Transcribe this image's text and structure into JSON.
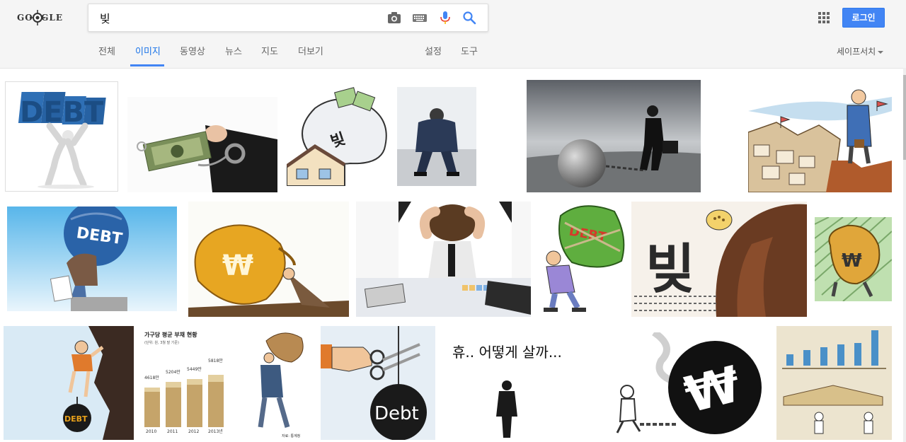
{
  "logo": {
    "text": "GOOGLE"
  },
  "search": {
    "query": "빚",
    "placeholder": ""
  },
  "search_icons": [
    "camera-icon",
    "keyboard-icon",
    "microphone-icon",
    "search-icon"
  ],
  "tabs": {
    "all": "전체",
    "images": "이미지",
    "videos": "동영상",
    "news": "뉴스",
    "maps": "지도",
    "more": "더보기",
    "settings": "설정",
    "tools": "도구"
  },
  "header_right": {
    "login": "로그인",
    "safesearch": "세이프서치"
  },
  "colors": {
    "accent": "#4285f4",
    "header_bg": "#f5f5f5"
  },
  "images": {
    "debt_word": "DEBT",
    "debt_word_title": "Debt",
    "bitt_word": "빚",
    "sigh_text": "휴.. 어떻게 살까...",
    "chart_title": "가구당 평균 부채 현황",
    "chart_sub": "(단위: 원, 3월 말 기준)",
    "chart_years": [
      "2010",
      "2011",
      "2012",
      "2013년"
    ],
    "chart_totals": [
      "4618만",
      "5204만",
      "5449만",
      "5818만"
    ],
    "chart_source": "자료: 통계청",
    "won_sign": "₩"
  }
}
